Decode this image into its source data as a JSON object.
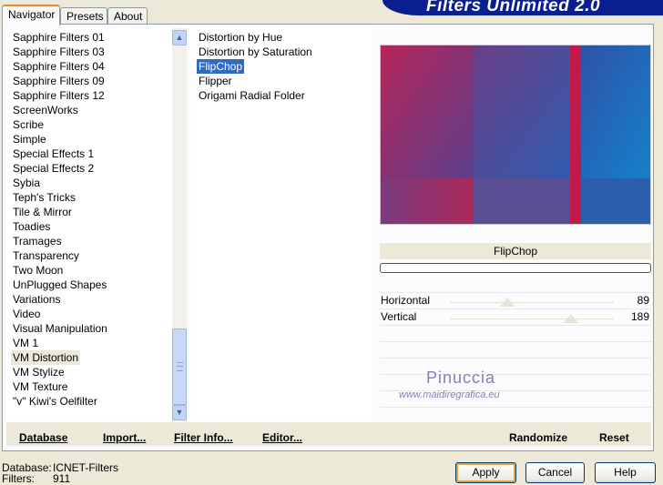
{
  "tabs": [
    "Navigator",
    "Presets",
    "About"
  ],
  "banner_title": "Filters Unlimited 2.0",
  "categories": [
    "Sapphire Filters 01",
    "Sapphire Filters 03",
    "Sapphire Filters 04",
    "Sapphire Filters 09",
    "Sapphire Filters 12",
    "ScreenWorks",
    "Scribe",
    "Simple",
    "Special Effects 1",
    "Special Effects 2",
    "Sybia",
    "Teph's Tricks",
    "Tile & Mirror",
    "Toadies",
    "Tramages",
    "Transparency",
    "Two Moon",
    "UnPlugged Shapes",
    "Variations",
    "Video",
    "Visual Manipulation",
    "VM 1",
    "VM Distortion",
    "VM Stylize",
    "VM Texture",
    "\"v\" Kiwi's Oelfilter"
  ],
  "selected_category": "VM Distortion",
  "filters": [
    "Distortion by Hue",
    "Distortion by Saturation",
    "FlipChop",
    "Flipper",
    "Origami Radial Folder"
  ],
  "selected_filter": "FlipChop",
  "preview_title": "FlipChop",
  "params": [
    {
      "label": "Horizontal",
      "value": "89",
      "level": 0.35
    },
    {
      "label": "Vertical",
      "value": "189",
      "level": 0.74
    }
  ],
  "watermark": {
    "name": "Pinuccia",
    "url": "www.maidiregrafica.eu"
  },
  "bottom_links": [
    "Database",
    "Import...",
    "Filter Info...",
    "Editor..."
  ],
  "right_links": [
    "Randomize",
    "Reset"
  ],
  "status": {
    "database_label": "Database:",
    "database_value": "ICNET-Filters",
    "filters_label": "Filters:",
    "filters_value": "911"
  },
  "buttons": {
    "apply": "Apply",
    "cancel": "Cancel",
    "help": "Help"
  },
  "colors": {
    "banner": "#0a1f8f",
    "selection": "#316ac5"
  }
}
